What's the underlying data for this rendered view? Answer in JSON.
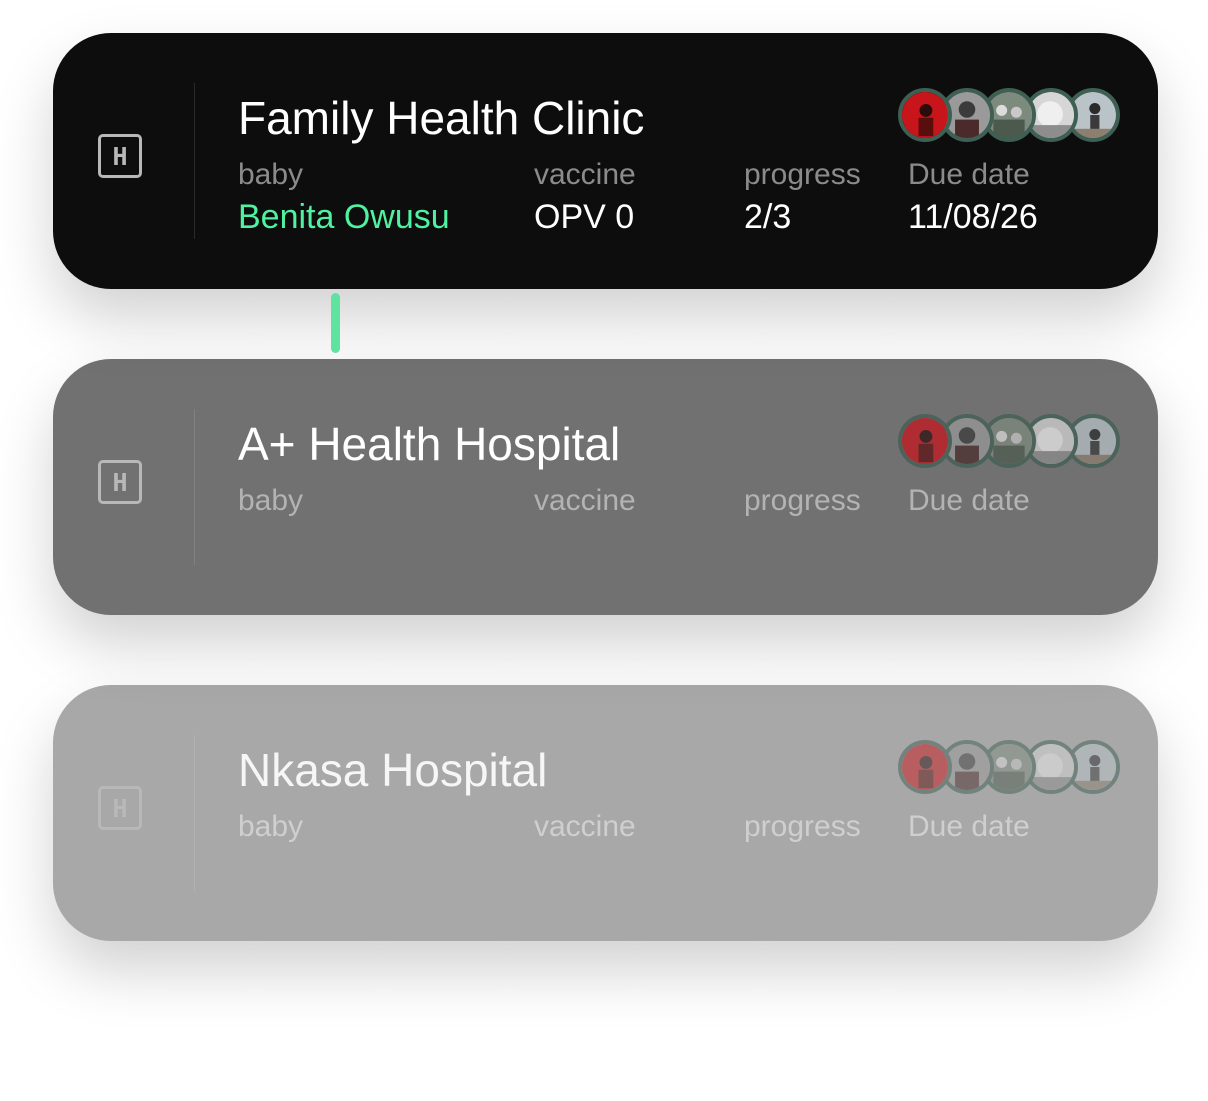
{
  "cards": [
    {
      "title": "Family Health Clinic",
      "icon": "hospital-icon",
      "labels": {
        "baby": "baby",
        "vaccine": "vaccine",
        "progress": "progress",
        "due": "Due date"
      },
      "values": {
        "baby": "Benita Owusu",
        "vaccine": "OPV 0",
        "progress": "2/3",
        "due": "11/08/26"
      }
    },
    {
      "title": "A+ Health Hospital",
      "icon": "hospital-icon",
      "labels": {
        "baby": "baby",
        "vaccine": "vaccine",
        "progress": "progress",
        "due": "Due date"
      }
    },
    {
      "title": "Nkasa Hospital",
      "icon": "hospital-icon",
      "labels": {
        "baby": "baby",
        "vaccine": "vaccine",
        "progress": "progress",
        "due": "Due date"
      }
    }
  ],
  "icon_glyph": "H",
  "colors": {
    "card_active": "#0d0d0d",
    "card_second": "#717171",
    "card_third": "#a8a8a8",
    "accent_green": "#4ef2a0",
    "avatar_ring": "#3e5f53"
  }
}
